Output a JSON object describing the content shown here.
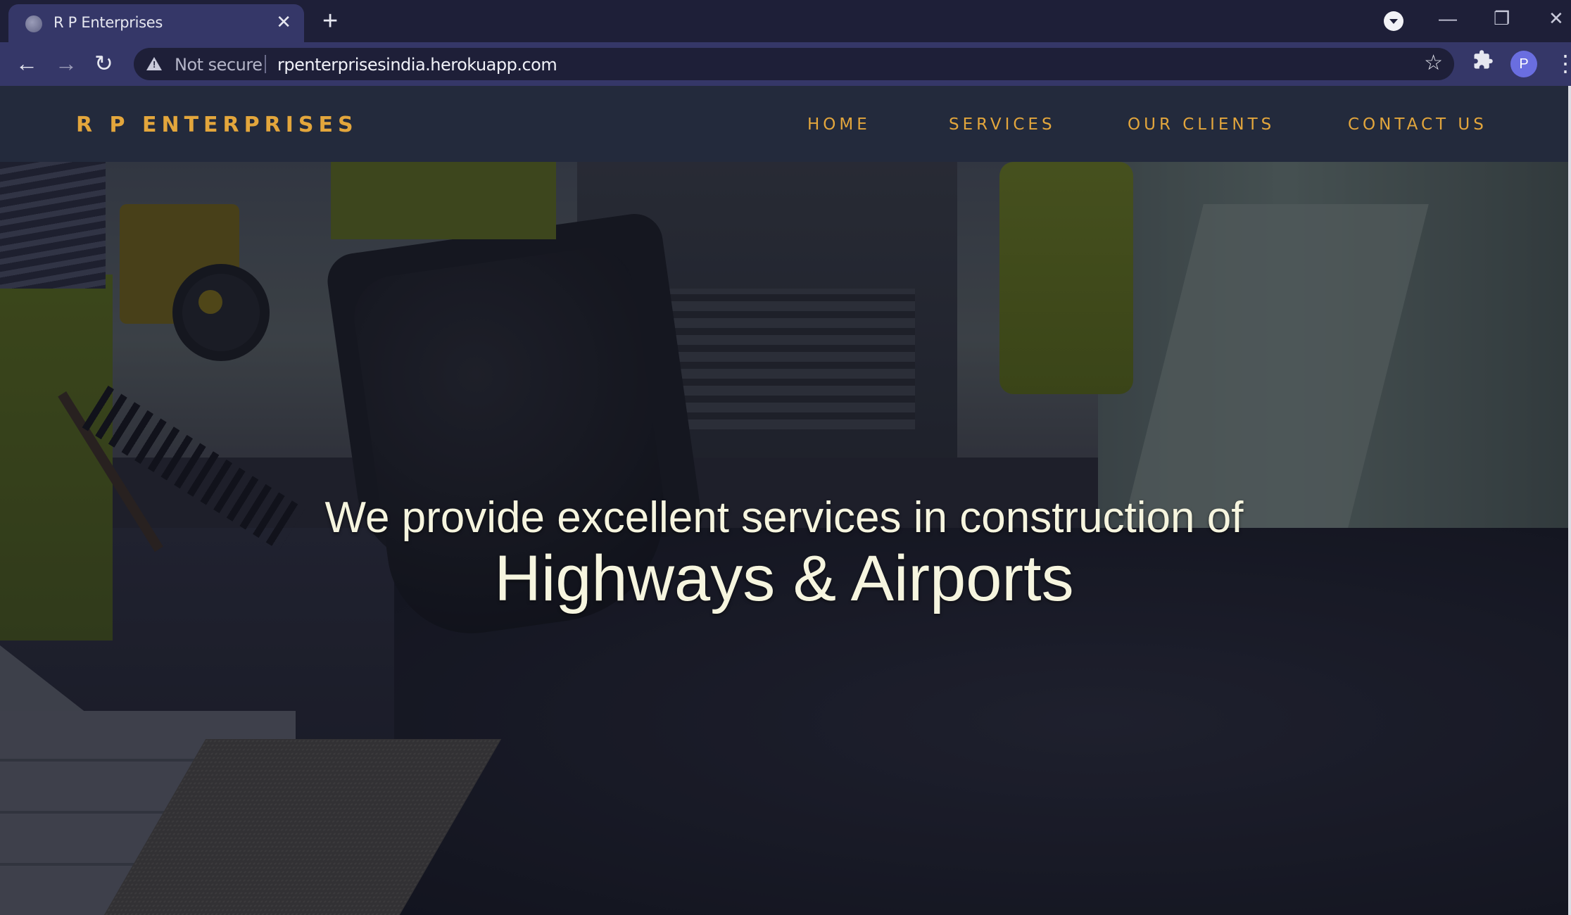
{
  "browser": {
    "tab_title": "R P Enterprises",
    "tab_close": "✕",
    "new_tab": "+",
    "security_label": "Not secure",
    "url": "rpenterprisesindia.herokuapp.com",
    "profile_initial": "P",
    "icons": {
      "back": "←",
      "forward": "→",
      "reload": "↻",
      "bookmark": "☆",
      "extensions": "puzzle",
      "menu": "⋮",
      "minimize": "—",
      "restore": "❐",
      "close": "✕"
    }
  },
  "site": {
    "brand": "R P ENTERPRISES",
    "nav": [
      "HOME",
      "SERVICES",
      "OUR CLIENTS",
      "CONTACT US"
    ]
  },
  "hero": {
    "line1": "We provide excellent services in construction of",
    "line2": "Highways & Airports"
  },
  "colors": {
    "accent": "#e3a63c",
    "header_bg": "#232a3c",
    "headline": "#f6f5df"
  }
}
